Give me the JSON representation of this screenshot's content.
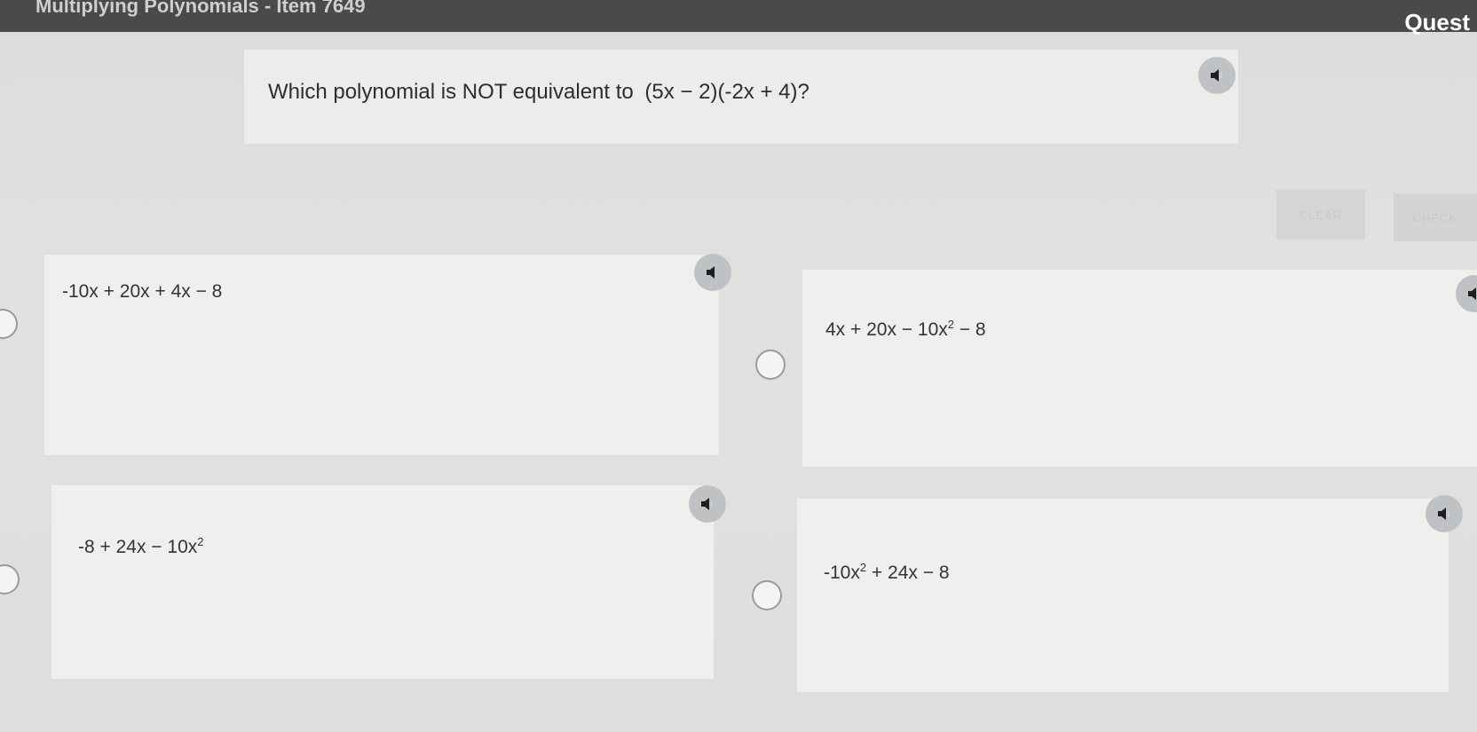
{
  "header": {
    "title": "Multiplying Polynomials - Item 7649",
    "right_label": "Quest"
  },
  "question": {
    "prompt": "Which polynomial is NOT equivalent to",
    "expression": "(5x − 2)(-2x + 4)?",
    "audio_icon": "speaker-icon"
  },
  "actions": {
    "clear_label": "CLEAR",
    "check_label": "CHECK"
  },
  "options": [
    {
      "text": "-10x + 20x + 4x − 8"
    },
    {
      "pre": "4x + 20x − 10x",
      "exp": "2",
      "post": " − 8"
    },
    {
      "pre": "-8 + 24x − 10x",
      "exp": "2",
      "post": ""
    },
    {
      "pre": "-10x",
      "exp": "2",
      "post": " + 24x − 8"
    }
  ],
  "colors": {
    "background": "#dededc",
    "card": "#efefed",
    "audio_button": "#bfc2c4",
    "top_bar": "#4a4a4c"
  }
}
